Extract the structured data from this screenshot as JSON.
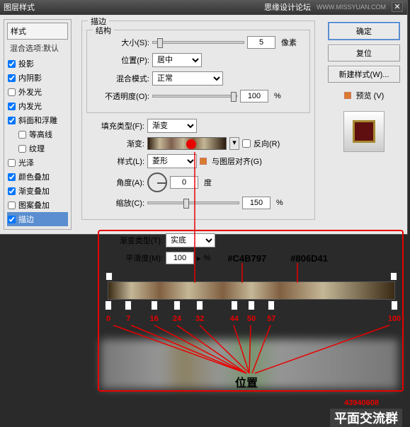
{
  "title": "图层样式",
  "watermark_site": "思缘设计论坛",
  "watermark_url": "WWW.MISSYUAN.COM",
  "sidebar": {
    "header": "样式",
    "sub": "混合选项:默认",
    "items": [
      {
        "label": "投影",
        "checked": true
      },
      {
        "label": "内阴影",
        "checked": true
      },
      {
        "label": "外发光",
        "checked": false
      },
      {
        "label": "内发光",
        "checked": true
      },
      {
        "label": "斜面和浮雕",
        "checked": true
      },
      {
        "label": "等高线",
        "checked": false,
        "indent": true
      },
      {
        "label": "纹理",
        "checked": false,
        "indent": true
      },
      {
        "label": "光泽",
        "checked": false
      },
      {
        "label": "颜色叠加",
        "checked": true
      },
      {
        "label": "渐变叠加",
        "checked": true
      },
      {
        "label": "图案叠加",
        "checked": false
      },
      {
        "label": "描边",
        "checked": true,
        "selected": true
      }
    ]
  },
  "stroke": {
    "group_label": "描边",
    "struct_label": "结构",
    "size_label": "大小(S):",
    "size_val": "5",
    "size_unit": "像素",
    "pos_label": "位置(P):",
    "pos_val": "居中",
    "blend_label": "混合模式:",
    "blend_val": "正常",
    "opacity_label": "不透明度(O):",
    "opacity_val": "100",
    "pct": "%",
    "fill_label": "填充类型(F):",
    "fill_val": "渐变",
    "grad_label": "渐变:",
    "reverse_label": "反向(R)",
    "style_label": "样式(L):",
    "style_val": "菱形",
    "align_label": "与图层对齐(G)",
    "angle_label": "角度(A):",
    "angle_val": "0",
    "angle_unit": "度",
    "scale_label": "缩放(C):",
    "scale_val": "150"
  },
  "buttons": {
    "ok": "确定",
    "cancel": "复位",
    "new": "新建样式(W)...",
    "preview": "预览 (V)"
  },
  "editor": {
    "type_label": "渐变类型(T):",
    "type_val": "实底",
    "smooth_label": "平滑度(M):",
    "smooth_val": "100",
    "anno1": "#C4B797",
    "anno2": "#806D41",
    "stops": [
      "0",
      "7",
      "16",
      "24",
      "32",
      "44",
      "50",
      "57",
      "100"
    ],
    "pos_txt": "位置"
  },
  "wm": {
    "id": "43940608",
    "grp": "平面交流群"
  }
}
